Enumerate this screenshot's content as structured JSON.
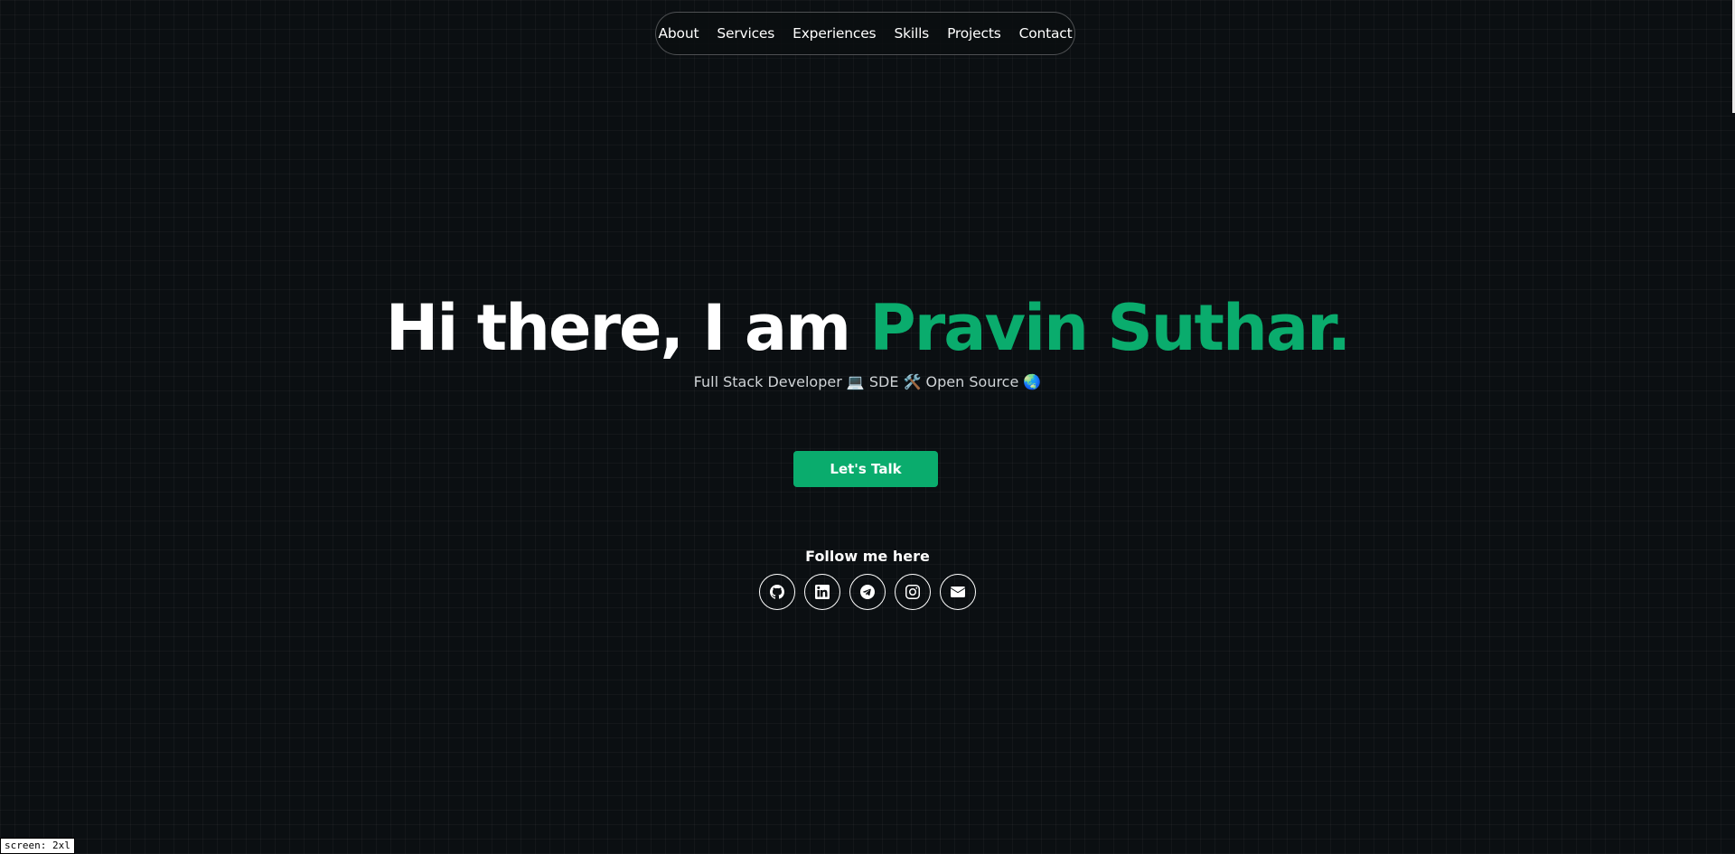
{
  "nav": {
    "items": [
      {
        "label": "About"
      },
      {
        "label": "Services"
      },
      {
        "label": "Experiences"
      },
      {
        "label": "Skills"
      },
      {
        "label": "Projects"
      },
      {
        "label": "Contact"
      }
    ]
  },
  "hero": {
    "greeting": "Hi there, I am",
    "name_first": "Pravin",
    "name_last": "Suthar.",
    "subtitle": "Full Stack Developer 💻 SDE 🛠️ Open Source 🌏",
    "cta_label": "Let's Talk"
  },
  "follow": {
    "label": "Follow me here",
    "links": [
      {
        "icon": "github-icon"
      },
      {
        "icon": "linkedin-icon"
      },
      {
        "icon": "telegram-icon"
      },
      {
        "icon": "instagram-icon"
      },
      {
        "icon": "email-icon"
      }
    ]
  },
  "debug": {
    "screen_label": "screen: 2xl"
  },
  "colors": {
    "background": "#0b0f12",
    "accent": "#0aac6d",
    "text": "#ffffff"
  }
}
